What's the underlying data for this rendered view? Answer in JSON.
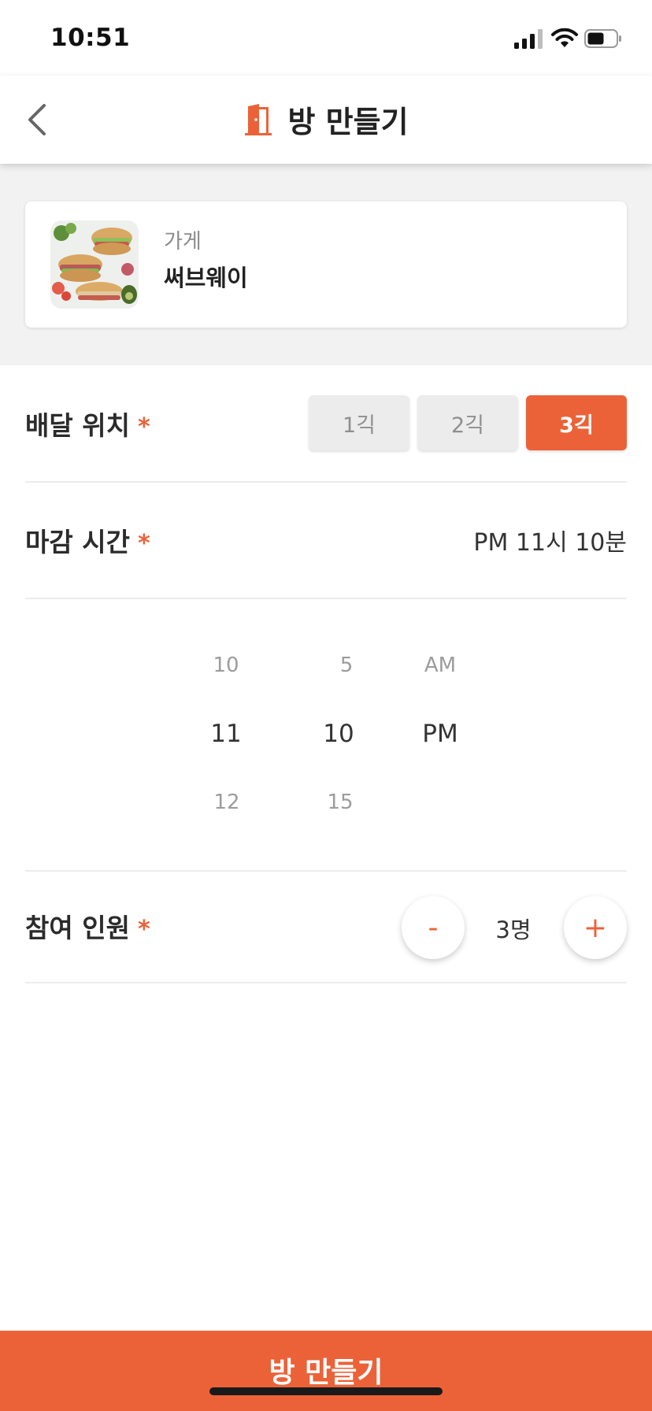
{
  "status_bar": {
    "time": "10:51"
  },
  "header": {
    "title": "방 만들기",
    "back_icon": "chevron-left-icon",
    "title_icon": "door-icon"
  },
  "store": {
    "label": "가게",
    "name": "써브웨이"
  },
  "delivery_location": {
    "label": "배달 위치",
    "required_mark": "*",
    "options": [
      "1긱",
      "2긱",
      "3긱"
    ],
    "selected": "3긱"
  },
  "deadline": {
    "label": "마감 시간",
    "required_mark": "*",
    "value": "PM 11시 10분",
    "picker": {
      "hour": {
        "prev": "10",
        "selected": "11",
        "next": "12"
      },
      "minute": {
        "prev": "5",
        "selected": "10",
        "next": "15"
      },
      "period": {
        "prev": "AM",
        "selected": "PM"
      }
    }
  },
  "participants": {
    "label": "참여 인원",
    "required_mark": "*",
    "decrement_label": "-",
    "increment_label": "+",
    "value": "3명"
  },
  "footer": {
    "create_label": "방 만들기"
  },
  "colors": {
    "accent": "#ec6238",
    "button_off": "#ececec",
    "section_bg": "#f2f2f2"
  }
}
